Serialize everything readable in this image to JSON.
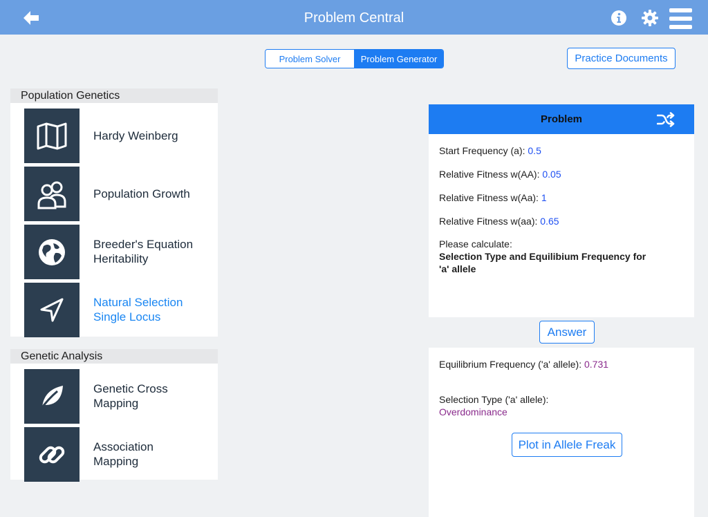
{
  "navbar": {
    "title": "Problem Central",
    "icons": [
      "back-arrow-icon",
      "info-icon",
      "gear-icon",
      "menu-icon"
    ]
  },
  "segmented": {
    "options": [
      "Problem Solver",
      "Problem Generator"
    ],
    "selected": "Problem Generator"
  },
  "practice_button": "Practice Documents",
  "sections": [
    {
      "title": "Population Genetics",
      "items": [
        {
          "label": "Hardy Weinberg",
          "icon": "map-icon"
        },
        {
          "label": "Population Growth",
          "icon": "users-icon"
        },
        {
          "label": "Breeder's Equation\nHeritability",
          "icon": "globe-icon"
        },
        {
          "label": "Natural Selection\nSingle Locus",
          "icon": "navigation-arrow-icon",
          "selected": true
        }
      ]
    },
    {
      "title": "Genetic Analysis",
      "items": [
        {
          "label": "Genetic Cross\nMapping",
          "icon": "leaf-icon"
        },
        {
          "label": "Association\nMapping",
          "icon": "link-icon"
        }
      ]
    }
  ],
  "problem": {
    "header": "Problem",
    "fields": [
      {
        "label": "Start Frequency (a):",
        "value": "0.5"
      },
      {
        "label": "Relative Fitness w(AA):",
        "value": "0.05"
      },
      {
        "label": "Relative Fitness w(Aa):",
        "value": "1"
      },
      {
        "label": "Relative Fitness w(aa):",
        "value": "0.65"
      }
    ],
    "prompt": "Please calculate:",
    "question_line1": "Selection Type and Equilibium Frequency for",
    "question_line2": "'a' allele"
  },
  "answer_button": "Answer",
  "result": {
    "eq_label": "Equilibrium Frequency ('a' allele):",
    "eq_value": "0.731",
    "type_label": "Selection Type ('a' allele):",
    "type_value": "Overdominance",
    "plot_button": "Plot in Allele Freak"
  },
  "colors": {
    "nav_bar": "#6a9fe2",
    "accent": "#1d7cf2",
    "tile": "#2c3e50",
    "value_blue": "#1d4ff2",
    "value_purple": "#8a2b8c"
  }
}
